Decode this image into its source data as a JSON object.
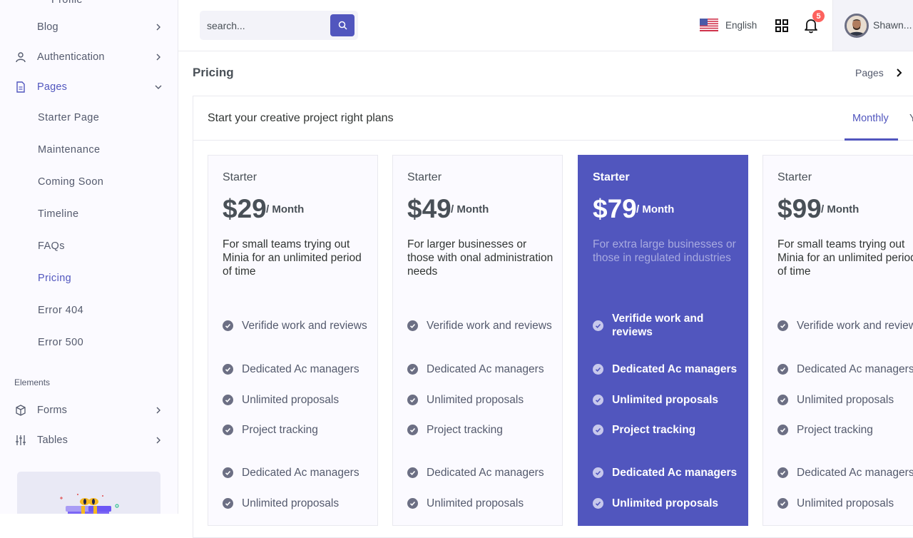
{
  "sidebar": {
    "top_partial_item": "Profile",
    "blog": "Blog",
    "authentication": "Authentication",
    "pages": "Pages",
    "sub_items": [
      {
        "label": "Starter Page",
        "active": false
      },
      {
        "label": "Maintenance",
        "active": false
      },
      {
        "label": "Coming Soon",
        "active": false
      },
      {
        "label": "Timeline",
        "active": false
      },
      {
        "label": "FAQs",
        "active": false
      },
      {
        "label": "Pricing",
        "active": true
      },
      {
        "label": "Error 404",
        "active": false
      },
      {
        "label": "Error 500",
        "active": false
      }
    ],
    "elements_title": "Elements",
    "forms": "Forms",
    "tables": "Tables",
    "promo_icon": "gift-icon"
  },
  "topbar": {
    "search_placeholder": "search...",
    "language": "English",
    "notification_count": "5",
    "user_name": "Shawn..."
  },
  "page": {
    "title": "Pricing",
    "breadcrumb": "Pages"
  },
  "card": {
    "title": "Start your creative project right plans",
    "tabs": [
      "Monthly",
      "Yearly"
    ],
    "active_tab": "Monthly"
  },
  "plans": [
    {
      "name": "Starter",
      "price": "$29",
      "period": "/  Month",
      "description": "For small teams trying out Minia for an unlimited period of time",
      "features": [
        "Verifide work and reviews",
        "Dedicated Ac managers",
        "Unlimited proposals",
        "Project tracking",
        "Dedicated Ac managers",
        "Unlimited proposals"
      ],
      "featured": false
    },
    {
      "name": "Starter",
      "price": "$49",
      "period": "/  Month",
      "description": "For larger businesses or those with onal administration needs",
      "features": [
        "Verifide work and reviews",
        "Dedicated Ac managers",
        "Unlimited proposals",
        "Project tracking",
        "Dedicated Ac managers",
        "Unlimited proposals"
      ],
      "featured": false
    },
    {
      "name": "Starter",
      "price": "$79",
      "period": "/  Month",
      "description": "For extra large businesses or those in regulated industries",
      "features": [
        "Verifide work and reviews",
        "Dedicated Ac managers",
        "Unlimited proposals",
        "Project tracking",
        "Dedicated Ac managers",
        "Unlimited proposals"
      ],
      "featured": true
    },
    {
      "name": "Starter",
      "price": "$99",
      "period": "/  Month",
      "description": "For small teams trying out Minia for an unlimited period of time",
      "features": [
        "Verifide work and reviews",
        "Dedicated Ac managers",
        "Unlimited proposals",
        "Project tracking",
        "Dedicated Ac managers",
        "Unlimited proposals"
      ],
      "featured": false
    }
  ],
  "colors": {
    "primary": "#5156be",
    "sidebar_bg": "#fbfaff",
    "badge": "#fd625e"
  }
}
